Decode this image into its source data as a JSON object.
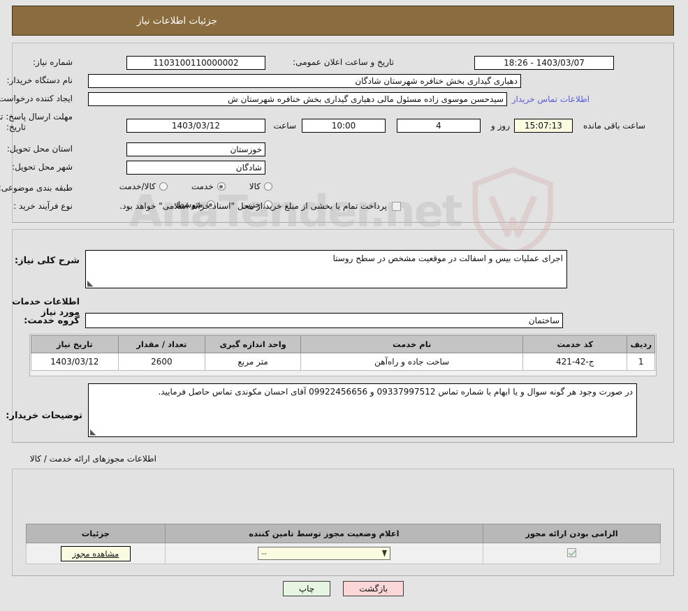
{
  "header": {
    "title": "جزئیات اطلاعات نیاز"
  },
  "watermark": {
    "text_left": "Ana",
    "text_right": "Tender.net",
    "full": "AnaTender.net"
  },
  "top_form": {
    "need_number_label": "شماره نیاز:",
    "need_number_value": "1103100110000002",
    "public_announce_label": "تاریخ و ساعت اعلان عمومی:",
    "public_announce_value": "1403/03/07 - 18:26",
    "buyer_org_label": "نام دستگاه خریدار:",
    "buyer_org_value": "دهیاری گیداری بخش خنافره شهرستان شادگان",
    "requester_label": "ایجاد کننده درخواست:",
    "requester_value": "سیدحسن موسوی زاده مسئول مالی دهیاری گیداری بخش خنافره شهرستان ش",
    "contact_link": "اطلاعات تماس خریدار",
    "deadline_label_line1": "مهلت ارسال پاسخ: تا",
    "deadline_label_line2": "تاریخ:",
    "deadline_date": "1403/03/12",
    "hour_label": "ساعت",
    "hour_value": "10:00",
    "days_value": "4",
    "days_label": "روز و",
    "countdown_value": "15:07:13",
    "countdown_label": "ساعت باقی مانده",
    "province_label": "استان محل تحویل:",
    "province_value": "خوزستان",
    "city_label": "شهر محل تحویل:",
    "city_value": "شادگان",
    "category_label": "طبقه بندی موضوعی:",
    "category_options": [
      {
        "label": "کالا",
        "selected": false
      },
      {
        "label": "خدمت",
        "selected": true
      },
      {
        "label": "کالا/خدمت",
        "selected": false
      }
    ],
    "process_label": "نوع فرآیند خرید :",
    "process_options": [
      {
        "label": "جزیی",
        "selected": false
      },
      {
        "label": "متوسط",
        "selected": true
      }
    ],
    "treasury_checkbox_checked": false,
    "treasury_text": "پرداخت تمام یا بخشی از مبلغ خرید،از محل \"اسناد خزانه اسلامی\" خواهد بود."
  },
  "mid_form": {
    "general_desc_label": "شرح کلی نیاز:",
    "general_desc_value": "اجرای عملیات بیس و اسفالت در موقعیت مشخص در سطح روستا",
    "services_info_heading": "اطلاعات خدمات مورد نیاز",
    "service_group_label": "گروه خدمت:",
    "service_group_value": "ساختمان",
    "table": {
      "headers": [
        "ردیف",
        "کد خدمت",
        "نام خدمت",
        "واحد اندازه گیری",
        "تعداد / مقدار",
        "تاریخ نیاز"
      ],
      "rows": [
        {
          "radif": "1",
          "code": "ج-42-421",
          "name": "ساخت جاده و راه‌آهن",
          "unit": "متر مربع",
          "qty": "2600",
          "date": "1403/03/12"
        }
      ]
    },
    "buyer_notes_label": "توضیحات خریدار:",
    "buyer_notes_value": "در صورت وجود هر گونه سوال و یا ابهام با شماره تماس 09337997512 و 09922456656 آقای احسان مکوندی تماس حاصل فرمایید."
  },
  "permits": {
    "section_title": "اطلاعات مجوزهای ارائه خدمت / کالا",
    "headers": [
      "الزامی بودن ارائه مجوز",
      "اعلام وضعیت مجوز توسط تامین کننده",
      "جزئیات"
    ],
    "rows": [
      {
        "required_checked": true,
        "status_value": "--",
        "status_arrow": "▼",
        "details_button": "مشاهده مجوز"
      }
    ]
  },
  "footer": {
    "print_label": "چاپ",
    "back_label": "بازگشت"
  },
  "colors": {
    "header_bg": "#8b6c3e",
    "page_bg": "#e4e4e4",
    "panel_bg": "#e2e2e2",
    "link": "#5b5bd6",
    "print_btn": "#e6f5e1",
    "back_btn": "#fbd6d6",
    "yellow_field": "#fbfbe2"
  }
}
